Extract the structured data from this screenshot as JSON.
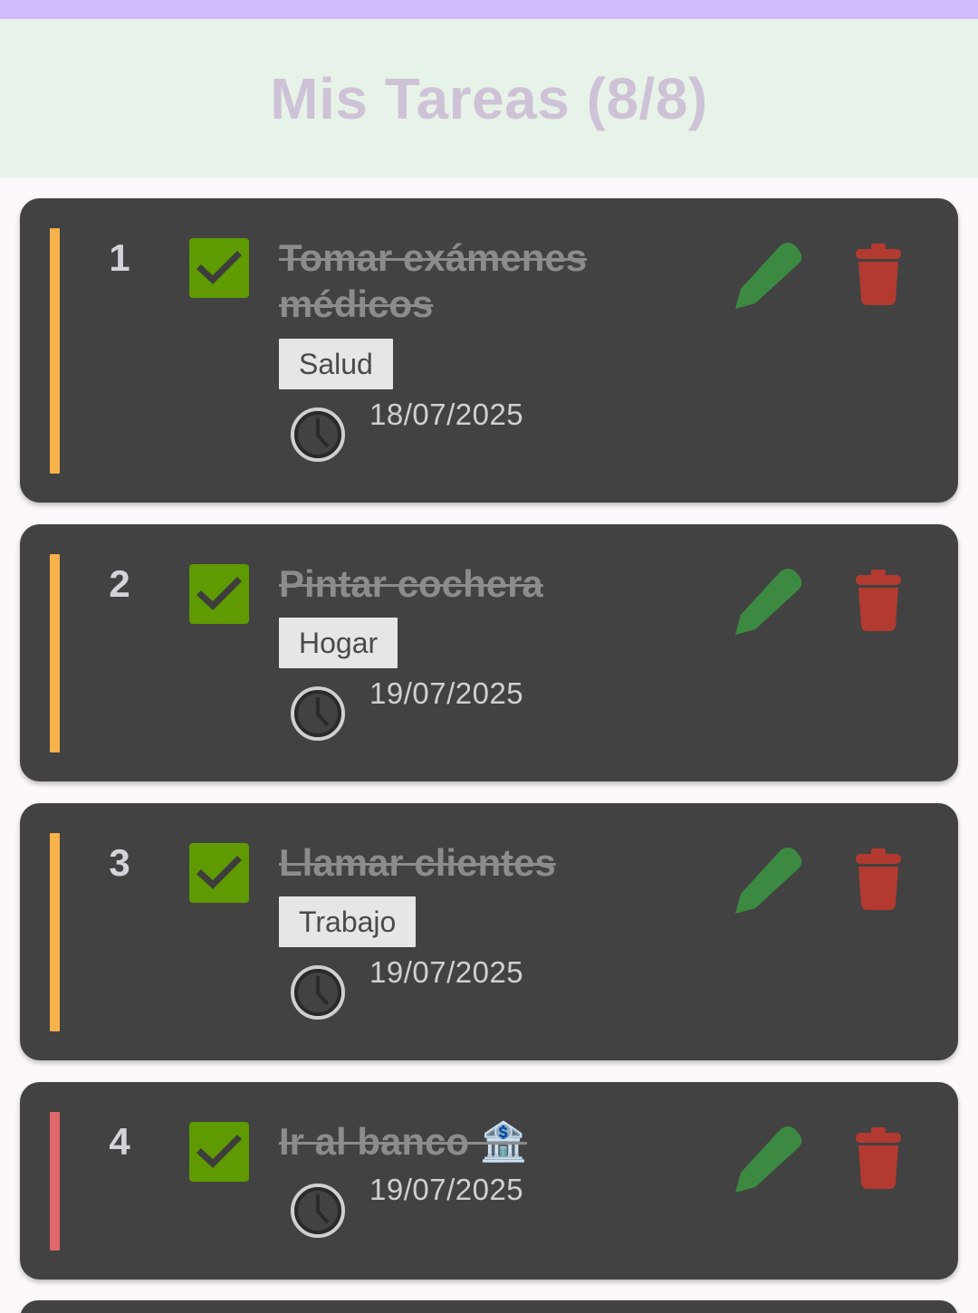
{
  "header": {
    "title": "Mis Tareas (8/8)"
  },
  "colors": {
    "status_bar": "#d0bcff",
    "header_bg": "#e7f3e8",
    "card_bg": "#424242",
    "check_green": "#5e9a00",
    "edit_green": "#2e7d32",
    "delete_red": "#b23a30",
    "priority_medium": "#f7b24a",
    "priority_high": "#e0686a"
  },
  "tasks": [
    {
      "number": "1",
      "title": "Tomar exámenes médicos",
      "category": "Salud",
      "date": "18/07/2025",
      "completed": true,
      "priority_color": "#f7b24a",
      "icons": [
        "check-icon",
        "clock-icon",
        "pencil-icon",
        "trash-icon"
      ]
    },
    {
      "number": "2",
      "title": "Pintar cochera",
      "category": "Hogar",
      "date": "19/07/2025",
      "completed": true,
      "priority_color": "#f7b24a",
      "icons": [
        "check-icon",
        "clock-icon",
        "pencil-icon",
        "trash-icon"
      ]
    },
    {
      "number": "3",
      "title": "Llamar clientes",
      "category": "Trabajo",
      "date": "19/07/2025",
      "completed": true,
      "priority_color": "#f7b24a",
      "icons": [
        "check-icon",
        "clock-icon",
        "pencil-icon",
        "trash-icon"
      ]
    },
    {
      "number": "4",
      "title": "Ir al banco 🏦",
      "category": "",
      "date": "19/07/2025",
      "completed": true,
      "priority_color": "#e0686a",
      "icons": [
        "check-icon",
        "clock-icon",
        "pencil-icon",
        "trash-icon"
      ]
    }
  ]
}
